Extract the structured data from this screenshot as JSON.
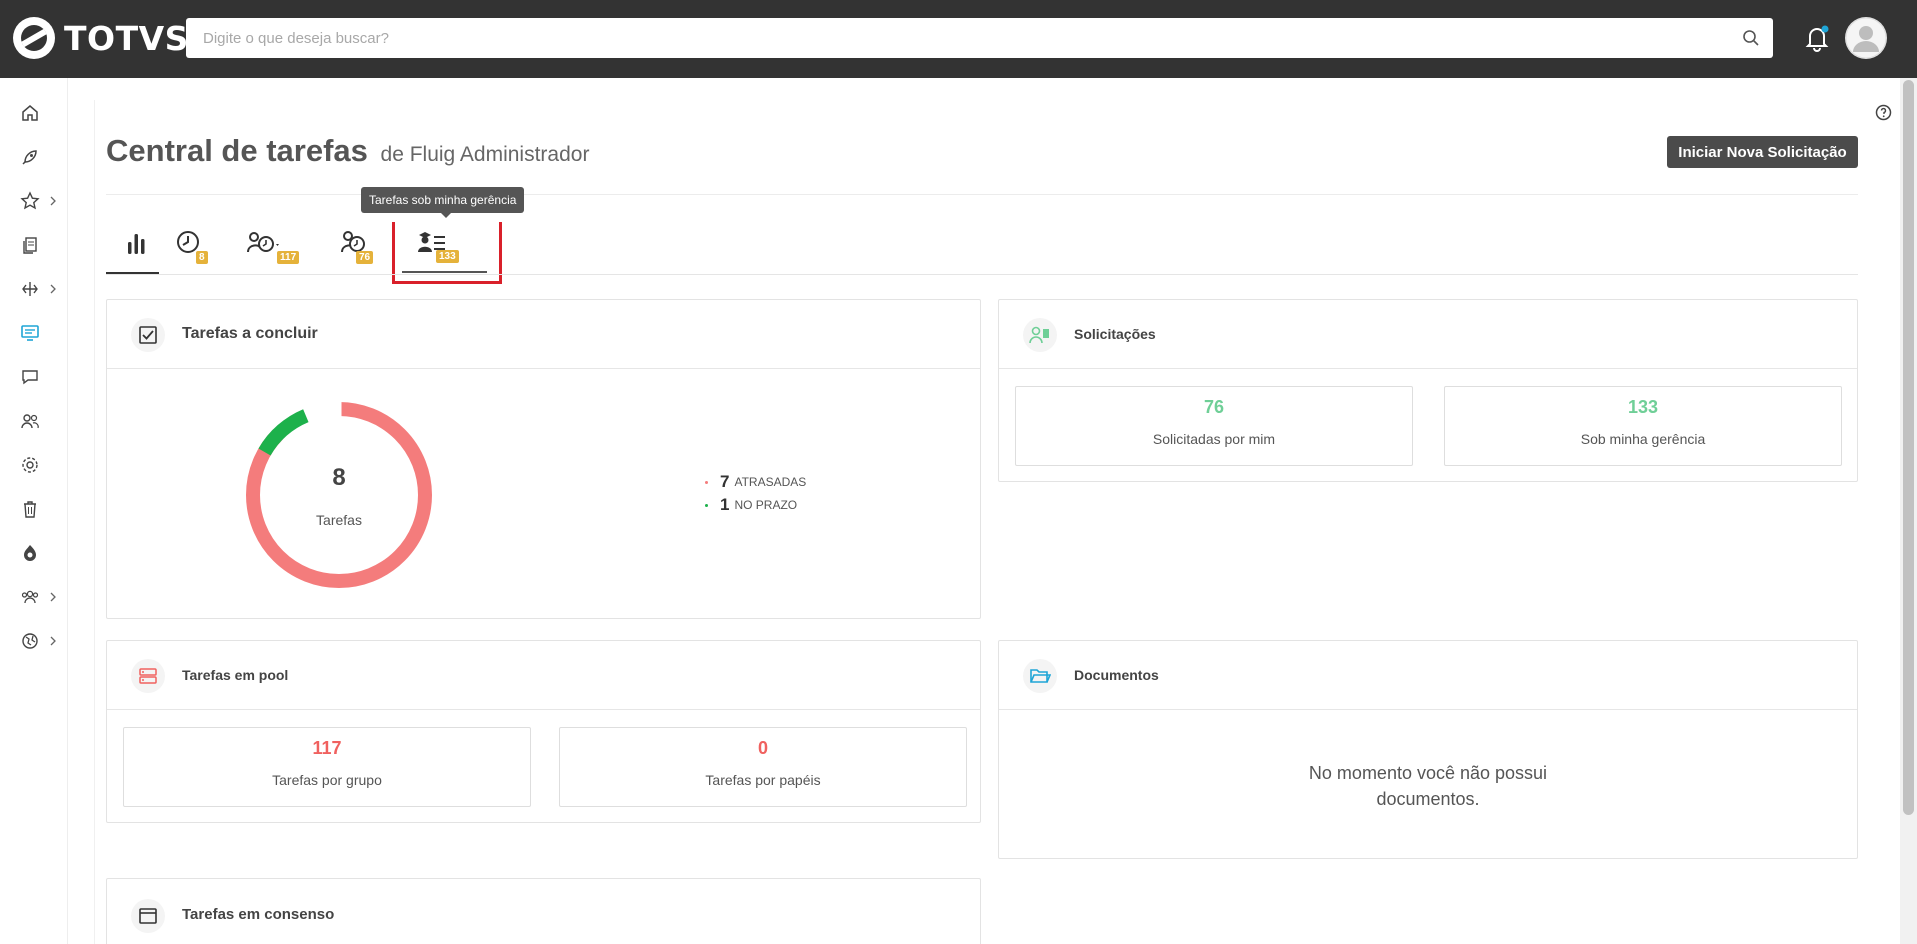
{
  "app": {
    "brand": "TOTVS"
  },
  "search": {
    "placeholder": "Digite o que deseja buscar?"
  },
  "page": {
    "title": "Central de tarefas",
    "subtitle": "de Fluig Administrador",
    "new_request_label": "Iniciar Nova Solicitação"
  },
  "tabs": [
    {
      "name": "dashboard",
      "badge": ""
    },
    {
      "name": "my-tasks",
      "badge": "8"
    },
    {
      "name": "pool-tasks",
      "badge": "117"
    },
    {
      "name": "my-requests",
      "badge": "76"
    },
    {
      "name": "managed-tasks",
      "badge": "133",
      "tooltip": "Tarefas sob minha gerência"
    }
  ],
  "tarefas_concluir": {
    "title": "Tarefas a concluir",
    "total": "8",
    "total_label": "Tarefas",
    "late_count": "7",
    "late_label": "ATRASADAS",
    "ontime_count": "1",
    "ontime_label": "NO PRAZO",
    "colors": {
      "late": "#f47c7c",
      "ontime": "#1db14b"
    }
  },
  "solicitacoes": {
    "title": "Solicitações",
    "items": [
      {
        "value": "76",
        "label": "Solicitadas por mim"
      },
      {
        "value": "133",
        "label": "Sob minha gerência"
      }
    ],
    "color": "#6fcf97"
  },
  "pool": {
    "title": "Tarefas em pool",
    "items": [
      {
        "value": "117",
        "label": "Tarefas por grupo"
      },
      {
        "value": "0",
        "label": "Tarefas por papéis"
      }
    ],
    "color": "#f0615f"
  },
  "documentos": {
    "title": "Documentos",
    "empty_line1": "No momento você não possui",
    "empty_line2": "documentos."
  },
  "consenso": {
    "title": "Tarefas em consenso"
  },
  "sidebar": {
    "icons": [
      "home-icon",
      "rocket-icon",
      "star-icon",
      "documents-icon",
      "workflow-icon",
      "task-central-icon",
      "chat-icon",
      "people-icon",
      "settings-icon",
      "trash-icon",
      "fluig-icon",
      "groups-icon",
      "globe-icon"
    ]
  }
}
